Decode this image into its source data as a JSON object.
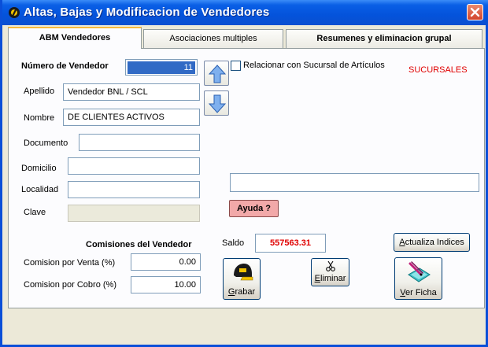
{
  "window": {
    "title": "Altas, Bajas y Modificacion de Vendedores"
  },
  "tabs": [
    {
      "label": "ABM Vendedores"
    },
    {
      "label": "Asociaciones multiples"
    },
    {
      "label": "Resumenes y eliminacion grupal"
    }
  ],
  "form": {
    "numero_label": "Número de Vendedor",
    "numero_value": "11",
    "apellido_label": "Apellido",
    "apellido_value": "Vendedor BNL / SCL",
    "nombre_label": "Nombre",
    "nombre_value": "DE CLIENTES ACTIVOS",
    "documento_label": "Documento",
    "documento_value": "",
    "domicilio_label": "Domicilio",
    "domicilio_value": "",
    "localidad_label": "Localidad",
    "localidad_value": "",
    "clave_label": "Clave",
    "clave_value": ""
  },
  "relacionar": {
    "label": "Relacionar con  Sucursal de Artículos",
    "checked": false
  },
  "sucursales_label": "SUCURSALES",
  "extra_field_value": "",
  "ayuda_label": "Ayuda ?",
  "comisiones": {
    "title": "Comisiones del Vendedor",
    "venta_label": "Comision por Venta (%)",
    "venta_value": "0.00",
    "cobro_label": "Comision por Cobro (%)",
    "cobro_value": "10.00"
  },
  "saldo": {
    "label": "Saldo",
    "value": "557563.31"
  },
  "buttons": {
    "actualiza_prefix": "A",
    "actualiza_rest": "ctualiza Indices",
    "grabar_prefix": "G",
    "grabar_rest": "rabar",
    "eliminar_prefix": "E",
    "eliminar_rest": "liminar",
    "ver_prefix": "V",
    "ver_rest": "er Ficha"
  },
  "colors": {
    "titlebar": "#0453db",
    "accent_red": "#e00000",
    "selection": "#316ac5",
    "help_button": "#f2a9a9"
  },
  "icons": [
    "app-icon",
    "close-icon",
    "arrow-up-icon",
    "arrow-down-icon",
    "save-cap-icon",
    "scissors-icon",
    "edit-card-icon"
  ]
}
